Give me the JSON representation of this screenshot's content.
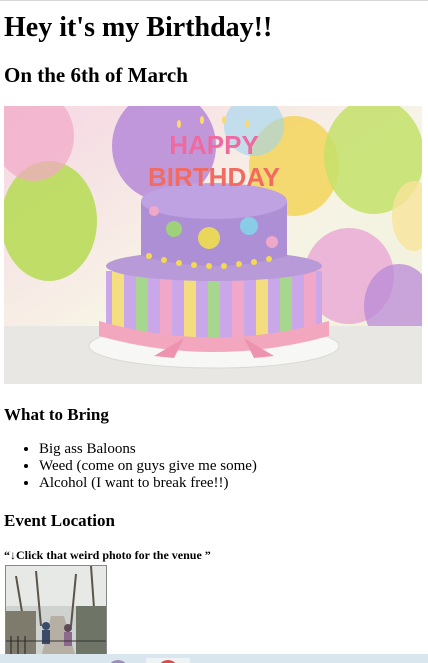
{
  "page": {
    "title": "Hey it's my Birthday!!",
    "subtitle": "On the 6th of March"
  },
  "hero": {
    "cake_line1": "HAPPY",
    "cake_line2": "BIRTHDAY"
  },
  "bring": {
    "heading": "What to Bring",
    "items": [
      "Big ass Baloons",
      "Weed (come on guys give me some)",
      "Alcohol (I want to break free!!)"
    ]
  },
  "location": {
    "heading": "Event Location",
    "quote": "“↓Click that weird photo for the venue ”"
  },
  "colors": {
    "background": "#ffffff",
    "bottom_bar": "#d9e6ee"
  }
}
